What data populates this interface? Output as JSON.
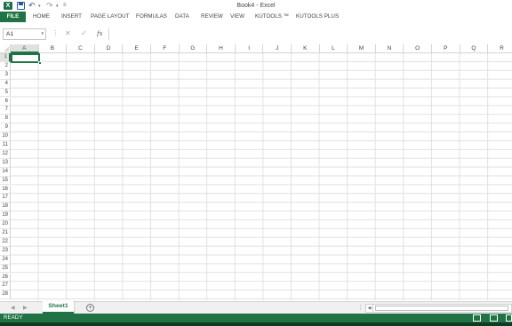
{
  "window": {
    "title": "Book4 - Excel",
    "app_icon": "X"
  },
  "quick_access": {
    "undo_glyph": "↶",
    "redo_glyph": "↷",
    "caret": "▾",
    "customize": "≡"
  },
  "ribbon": {
    "tabs": [
      "FILE",
      "HOME",
      "INSERT",
      "PAGE LAYOUT",
      "FORMULAS",
      "DATA",
      "REVIEW",
      "VIEW",
      "KUTOOLS ™",
      "KUTOOLS PLUS"
    ]
  },
  "formula_bar": {
    "name_box": "A1",
    "cancel_glyph": "✕",
    "enter_glyph": "✓",
    "fx_label": "fx",
    "dots": "⋮",
    "value": ""
  },
  "grid": {
    "columns": [
      "A",
      "B",
      "C",
      "D",
      "E",
      "F",
      "G",
      "H",
      "I",
      "J",
      "K",
      "L",
      "M",
      "N",
      "O",
      "P",
      "Q",
      "R"
    ],
    "rows": [
      "1",
      "2",
      "3",
      "4",
      "5",
      "6",
      "7",
      "8",
      "9",
      "10",
      "11",
      "12",
      "13",
      "14",
      "15",
      "16",
      "17",
      "18",
      "19",
      "20",
      "21",
      "22",
      "23",
      "24",
      "25",
      "26",
      "27",
      "28"
    ],
    "active_cell": "A1"
  },
  "sheets": {
    "tabs": [
      "Sheet1"
    ],
    "active": "Sheet1",
    "add_glyph": "+",
    "prev_glyph": "◀",
    "next_glyph": "▶"
  },
  "status": {
    "text": "READY"
  },
  "colors": {
    "accent": "#217346",
    "status_bar": "#217346"
  }
}
